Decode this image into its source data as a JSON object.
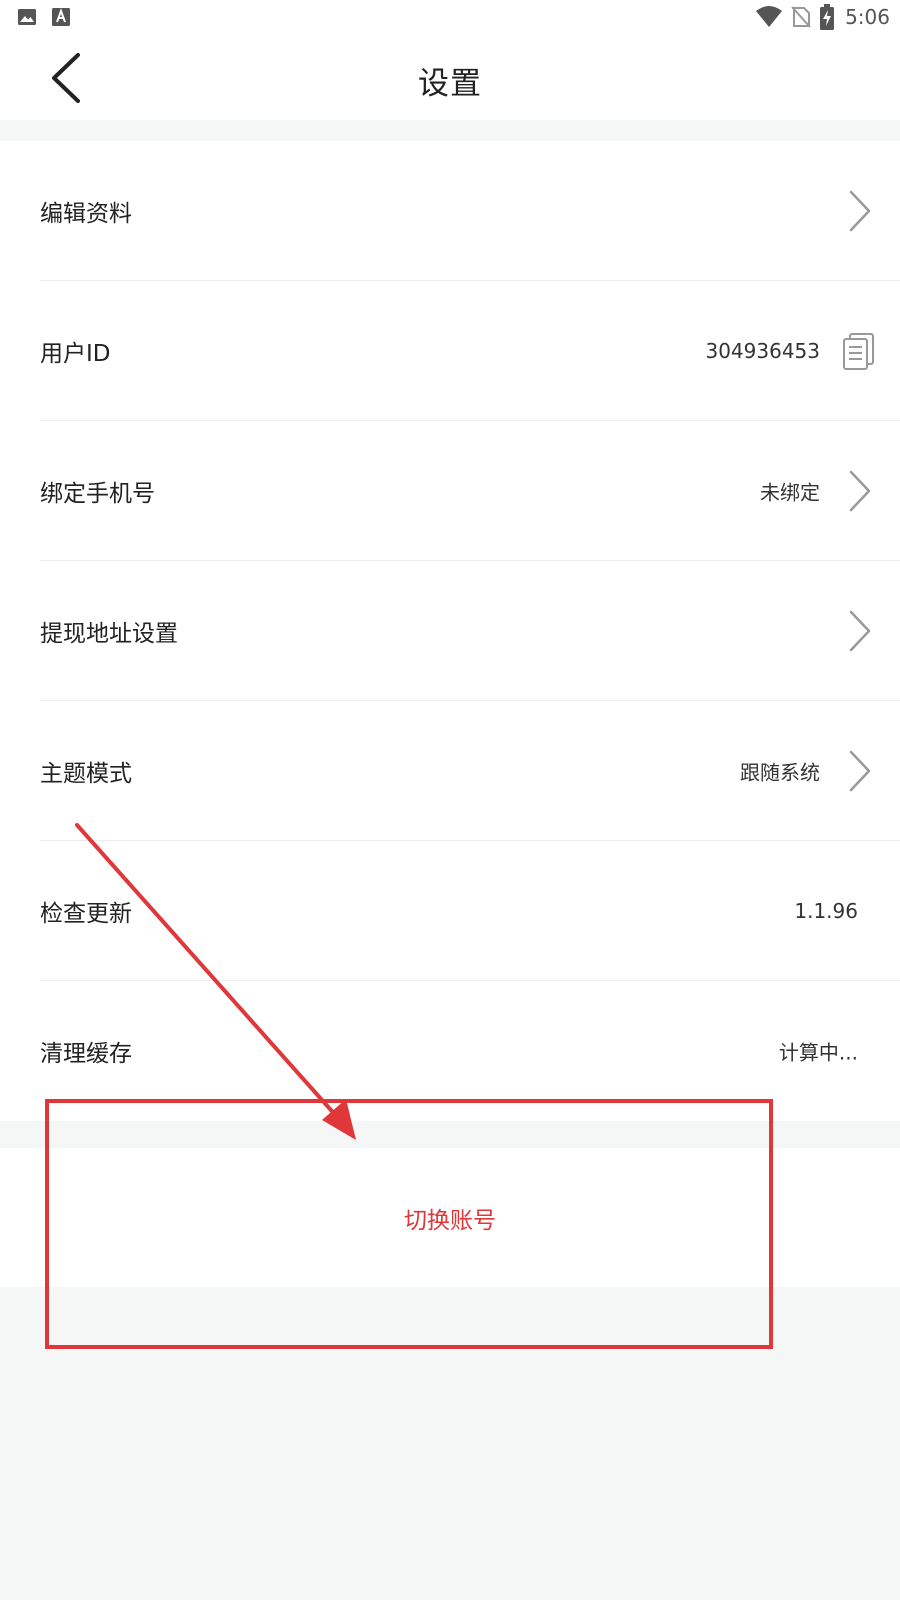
{
  "status_bar": {
    "time": "5:06",
    "left_icons": [
      "image-icon",
      "text-a-icon"
    ],
    "right_icons": [
      "wifi-icon",
      "no-sim-icon",
      "battery-charging-icon"
    ]
  },
  "nav": {
    "back_icon": "chevron-left-icon",
    "title": "设置"
  },
  "settings": {
    "items": [
      {
        "label": "编辑资料",
        "value": "",
        "trailing": "chevron-right-icon"
      },
      {
        "label": "用户ID",
        "value": "304936453",
        "trailing": "copy-icon"
      },
      {
        "label": "绑定手机号",
        "value": "未绑定",
        "trailing": "chevron-right-icon"
      },
      {
        "label": "提现地址设置",
        "value": "",
        "trailing": "chevron-right-icon"
      },
      {
        "label": "主题模式",
        "value": "跟随系统",
        "trailing": "chevron-right-icon"
      },
      {
        "label": "检查更新",
        "value": "1.1.96",
        "trailing": ""
      },
      {
        "label": "清理缓存",
        "value": "计算中...",
        "trailing": ""
      }
    ]
  },
  "switch_account": {
    "label": "切换账号"
  },
  "colors": {
    "accent_red": "#e0373a",
    "page_background": "#f5f6f6",
    "card_background": "#ffffff",
    "divider": "#ececec"
  }
}
